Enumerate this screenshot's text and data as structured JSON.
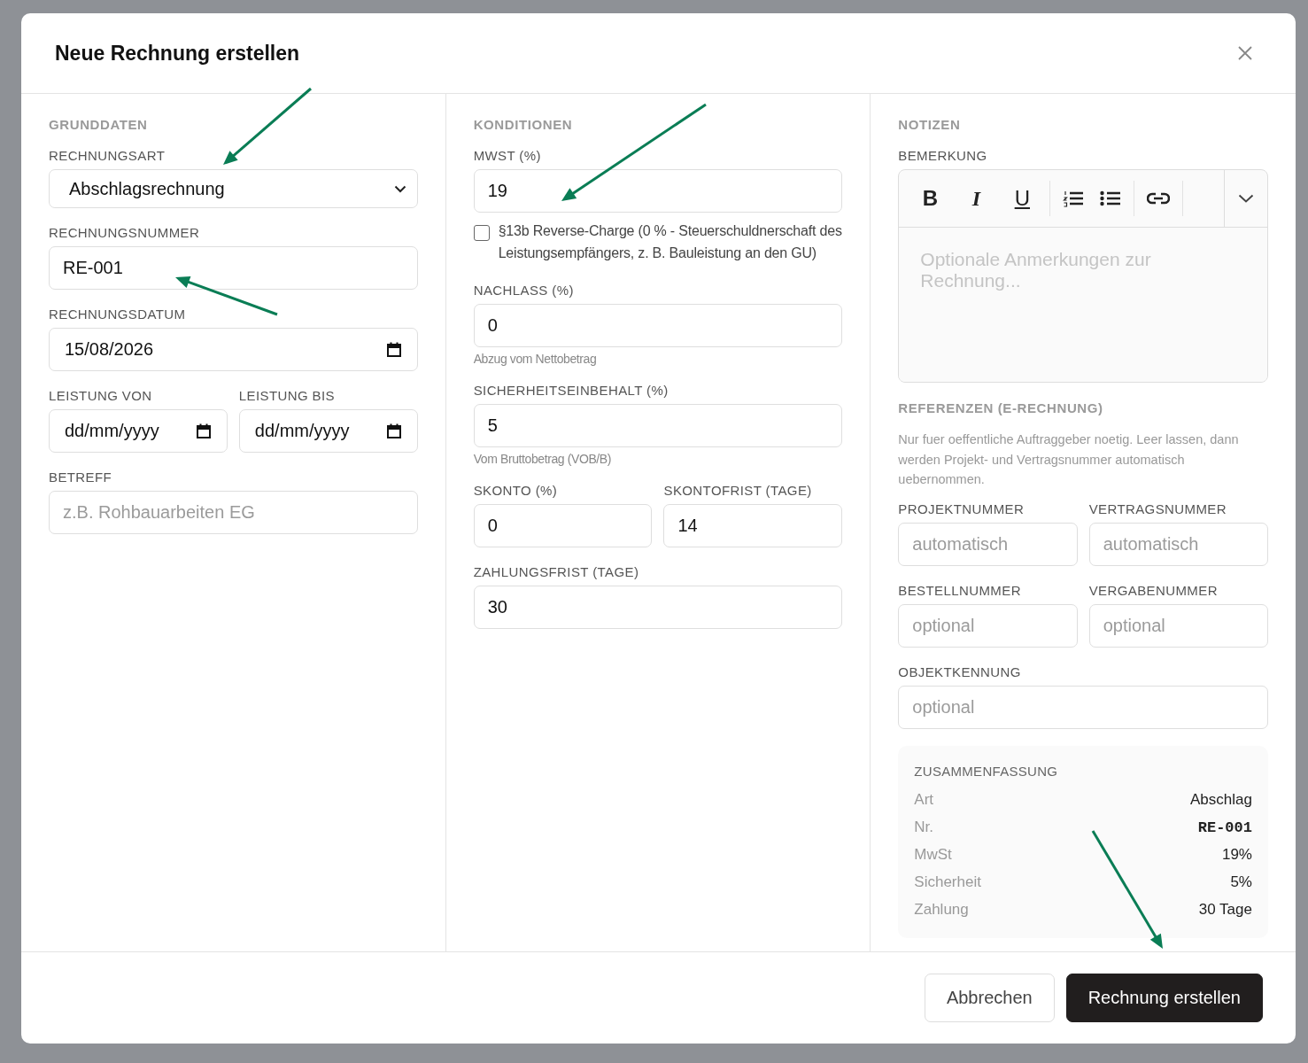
{
  "dialog": {
    "title": "Neue Rechnung erstellen"
  },
  "columns": [
    {
      "items": [
        {
          "kind": "heading",
          "text": "GRUNDDATEN"
        },
        {
          "kind": "fields",
          "fields": [
            {
              "kind": "select",
              "label": "RECHNUNGSART",
              "value": "Abschlagsrechnung"
            }
          ]
        },
        {
          "kind": "fields",
          "fields": [
            {
              "kind": "text",
              "label": "RECHNUNGSNUMMER",
              "value": "RE-001"
            }
          ]
        },
        {
          "kind": "fields",
          "fields": [
            {
              "kind": "date",
              "label": "RECHNUNGSDATUM",
              "value": "15/08/2026"
            }
          ]
        },
        {
          "kind": "fields",
          "fields": [
            {
              "kind": "date",
              "label": "LEISTUNG VON",
              "value": "dd/mm/yyyy"
            },
            {
              "kind": "date",
              "label": "LEISTUNG BIS",
              "value": "dd/mm/yyyy"
            }
          ]
        },
        {
          "kind": "fields",
          "fields": [
            {
              "kind": "text",
              "label": "BETREFF",
              "placeholder": "z.B. Rohbauarbeiten EG"
            }
          ]
        }
      ]
    },
    {
      "items": [
        {
          "kind": "heading",
          "text": "KONDITIONEN"
        },
        {
          "kind": "fields",
          "fields": [
            {
              "kind": "text",
              "label": "MWST (%)",
              "value": "19"
            }
          ]
        },
        {
          "kind": "checkbox",
          "text": "§13b Reverse-Charge (0 % - Steuerschuldnerschaft des Leistungsempfängers, z. B. Bauleistung an den GU)",
          "checked": false
        },
        {
          "kind": "fields",
          "fields": [
            {
              "kind": "text",
              "label": "NACHLASS (%)",
              "value": "0",
              "hint": "Abzug vom Nettobetrag"
            }
          ]
        },
        {
          "kind": "fields",
          "fields": [
            {
              "kind": "text",
              "label": "SICHERHEITSEINBEHALT (%)",
              "value": "5",
              "hint": "Vom Bruttobetrag (VOB/B)"
            }
          ]
        },
        {
          "kind": "fields",
          "fields": [
            {
              "kind": "text",
              "label": "SKONTO (%)",
              "value": "0"
            },
            {
              "kind": "text",
              "label": "SKONTOFRIST (TAGE)",
              "value": "14"
            }
          ]
        },
        {
          "kind": "fields",
          "fields": [
            {
              "kind": "text",
              "label": "ZAHLUNGSFRIST (TAGE)",
              "value": "30"
            }
          ]
        }
      ]
    },
    {
      "items": [
        {
          "kind": "heading",
          "text": "NOTIZEN"
        },
        {
          "kind": "editor",
          "label": "BEMERKUNG",
          "format_buttons": [
            "B",
            "I",
            "U"
          ],
          "placeholder": "Optionale Anmerkungen zur Rechnung..."
        },
        {
          "kind": "heading",
          "text": "REFERENZEN (E-RECHNUNG)"
        },
        {
          "kind": "note",
          "text": "Nur fuer oeffentliche Auftraggeber noetig. Leer lassen, dann werden Projekt- und Vertragsnummer automatisch uebernommen."
        },
        {
          "kind": "fields",
          "fields": [
            {
              "kind": "text",
              "label": "PROJEKTNUMMER",
              "placeholder": "automatisch"
            },
            {
              "kind": "text",
              "label": "VERTRAGSNUMMER",
              "placeholder": "automatisch"
            }
          ]
        },
        {
          "kind": "fields",
          "fields": [
            {
              "kind": "text",
              "label": "BESTELLNUMMER",
              "placeholder": "optional"
            },
            {
              "kind": "text",
              "label": "VERGABENUMMER",
              "placeholder": "optional"
            }
          ]
        },
        {
          "kind": "fields",
          "fields": [
            {
              "kind": "text",
              "label": "OBJEKTKENNUNG",
              "placeholder": "optional"
            }
          ]
        },
        {
          "kind": "summary",
          "title": "ZUSAMMENFASSUNG",
          "rows": [
            {
              "label": "Art",
              "value": "Abschlag",
              "kind": "text"
            },
            {
              "label": "Nr.",
              "value": "RE-001",
              "kind": "code"
            },
            {
              "label": "MwSt",
              "value": "19%",
              "kind": "text"
            },
            {
              "label": "Sicherheit",
              "value": "5%",
              "kind": "text"
            },
            {
              "label": "Zahlung",
              "value": "30 Tage",
              "kind": "text"
            }
          ]
        }
      ]
    }
  ],
  "buttons": [
    {
      "label": "Abbrechen",
      "kind": "secondary"
    },
    {
      "label": "Rechnung erstellen",
      "kind": "primary"
    }
  ]
}
